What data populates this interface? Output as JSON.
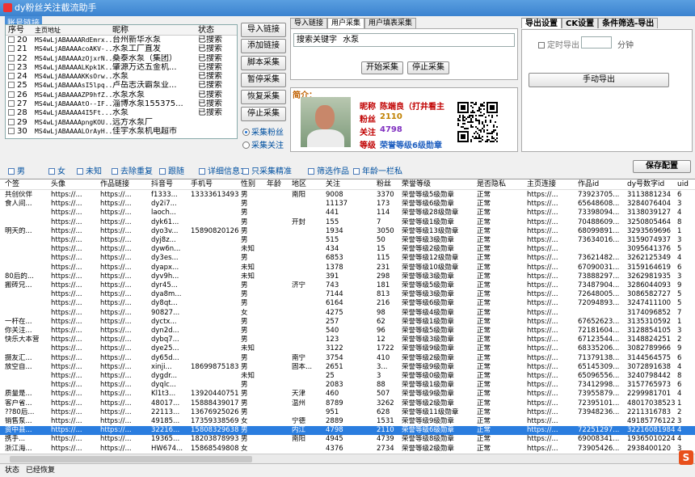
{
  "window": {
    "title": "dy粉丝关注截流助手",
    "group_label": "账号链接"
  },
  "links": {
    "headers": [
      "序号",
      "主页地址",
      "昵称",
      "状态"
    ],
    "rows": [
      [
        "20",
        "MS4wLjABAAAARdEmrx...",
        "台州新华水泵",
        "已搜索"
      ],
      [
        "21",
        "MS4wLjABAAAAcoAKV-...",
        "水泵工厂直发",
        "已搜索"
      ],
      [
        "22",
        "MS4wLjABAAAAzOjxrN...",
        "桑泰水泵（集团）",
        "已搜索"
      ],
      [
        "23",
        "MS4wLjABAAAALKpk1K...",
        "肇源万达五金机...",
        "已搜索"
      ],
      [
        "24",
        "MS4wLjABAAAAKKsOrw...",
        "水泵",
        "已搜索"
      ],
      [
        "25",
        "MS4wLjABAAAAsI5lpq...",
        "卢岳志沃霸泵业...",
        "已搜索"
      ],
      [
        "26",
        "MS4wLjABAAAAZP9hfZ...",
        "水泵水泵",
        "已搜索"
      ],
      [
        "27",
        "MS4wLjABAAAAtO--IF...",
        "淄博水泵155375...",
        "已搜索"
      ],
      [
        "28",
        "MS4wLjABAAAA4I5Ft...",
        "水泵",
        "已搜索"
      ],
      [
        "29",
        "MS4wLjABAAAApngKOU...",
        "远方水泵厂",
        ""
      ],
      [
        "30",
        "MS4wLjABAAAALOrAyH...",
        "佳宇水泵机电超市",
        ""
      ]
    ]
  },
  "buttons": {
    "import": "导入链接",
    "add": "添加链接",
    "script": "脚本采集",
    "pause": "暂停采集",
    "resume": "恢复采集",
    "stop": "停止采集",
    "start_search": "开始采集",
    "stop_search": "停止采集",
    "manual_export": "手动导出",
    "save_config": "保存配置"
  },
  "radios": {
    "fans": "采集粉丝",
    "follow": "采集关注"
  },
  "mid_tabs": [
    "导入链接",
    "用户采集",
    "用户填表采集"
  ],
  "search": {
    "label": "搜索关键字",
    "value": "水泵"
  },
  "profile": {
    "section": "简介：",
    "nick_label": "昵称",
    "nick": "陈端良（打井看主",
    "fans_label": "粉丝",
    "fans": "2110",
    "follow_label": "关注",
    "follow": "4798",
    "level_label": "等级",
    "level": "荣誉等级6级勋章"
  },
  "right_tabs": [
    "导出设置",
    "CK设置",
    "条件筛选-导出"
  ],
  "export": {
    "timed": "定时导出",
    "minutes": "分钟"
  },
  "options": [
    "男",
    "女",
    "未知",
    "去除重复",
    "跟随",
    "详细信息1",
    "只采集精准",
    "筛选作品",
    "年龄一栏私"
  ],
  "table": {
    "headers": [
      "个签",
      "头像",
      "作品链接",
      "抖音号",
      "手机号",
      "性别",
      "年龄",
      "地区",
      "关注",
      "粉丝",
      "荣誉等级",
      "是否隐私",
      "主页连接",
      "作品id",
      "dy号数字id",
      "uid"
    ],
    "rows": [
      [
        "共创伙伴",
        "https://...",
        "https://...",
        "f1333...",
        "13333613493",
        "男",
        "",
        "南阳",
        "9008",
        "3370",
        "荣誉等级5级勋章",
        "正常",
        "https://...",
        "73923705...",
        "3113881234",
        "6"
      ],
      [
        "食人间...",
        "https://...",
        "https://...",
        "dy2i7...",
        "",
        "男",
        "",
        "",
        "11137",
        "173",
        "荣誉等级6级勋章",
        "正常",
        "https://...",
        "65648608...",
        "3284076404",
        "3"
      ],
      [
        "",
        "https://...",
        "https://...",
        "laoch...",
        "",
        "男",
        "",
        "",
        "441",
        "114",
        "荣誉等级28级勋章",
        "正常",
        "https://...",
        "73398094...",
        "3138039127",
        "4"
      ],
      [
        "",
        "https://...",
        "https://...",
        "dyk61...",
        "",
        "男",
        "",
        "开封",
        "155",
        "7",
        "荣誉等级1级勋章",
        "正常",
        "https://...",
        "70488609...",
        "3250805464",
        "8"
      ],
      [
        "明天的...",
        "https://...",
        "https://...",
        "dyo3v...",
        "15890820126",
        "男",
        "",
        "",
        "1934",
        "3050",
        "荣誉等级13级勋章",
        "正常",
        "https://...",
        "68099891...",
        "3293569696",
        "1"
      ],
      [
        "",
        "https://...",
        "https://...",
        "dyj8z...",
        "",
        "男",
        "",
        "",
        "515",
        "50",
        "荣誉等级3级勋章",
        "正常",
        "https://...",
        "73634016...",
        "3159074937",
        "3"
      ],
      [
        "",
        "https://...",
        "https://...",
        "dyw6n...",
        "",
        "未知",
        "",
        "",
        "434",
        "15",
        "荣誉等级2级勋章",
        "正常",
        "https://...",
        "",
        "3095641376",
        "5"
      ],
      [
        "",
        "https://...",
        "https://...",
        "dy3es...",
        "",
        "男",
        "",
        "",
        "6853",
        "115",
        "荣誉等级12级勋章",
        "正常",
        "https://...",
        "73621482...",
        "3262125349",
        "4"
      ],
      [
        "",
        "https://...",
        "https://...",
        "dyapx...",
        "",
        "未知",
        "",
        "",
        "1378",
        "231",
        "荣誉等级10级勋章",
        "正常",
        "https://...",
        "67090031...",
        "3159164619",
        "6"
      ],
      [
        "80后的...",
        "https://...",
        "https://...",
        "dyv9h...",
        "",
        "未知",
        "",
        "",
        "391",
        "298",
        "荣誉等级3级勋章",
        "正常",
        "https://...",
        "73888297...",
        "3262981935",
        "3"
      ],
      [
        "搬砖兄...",
        "https://...",
        "https://...",
        "dyr45...",
        "",
        "男",
        "",
        "济宁",
        "743",
        "181",
        "荣誉等级5级勋章",
        "正常",
        "https://...",
        "73487904...",
        "3286044093",
        "9"
      ],
      [
        "",
        "https://...",
        "https://...",
        "dya8m...",
        "",
        "男",
        "",
        "",
        "7144",
        "813",
        "荣誉等级3级勋章",
        "正常",
        "https://...",
        "72648005...",
        "3086582727",
        "5"
      ],
      [
        "",
        "https://...",
        "https://...",
        "dy8qt...",
        "",
        "男",
        "",
        "",
        "6164",
        "216",
        "荣誉等级6级勋章",
        "正常",
        "https://...",
        "72094893...",
        "3247411100",
        "5"
      ],
      [
        "",
        "https://...",
        "https://...",
        "90827...",
        "",
        "女",
        "",
        "",
        "4275",
        "98",
        "荣誉等级4级勋章",
        "正常",
        "https://...",
        "",
        "3174096852",
        "7"
      ],
      [
        "一杆在...",
        "https://...",
        "https://...",
        "dyctx...",
        "",
        "男",
        "",
        "",
        "257",
        "62",
        "荣誉等级1级勋章",
        "正常",
        "https://...",
        "67652623...",
        "3135310592",
        "1"
      ],
      [
        "你关注...",
        "https://...",
        "https://...",
        "dyn2d...",
        "",
        "男",
        "",
        "",
        "540",
        "96",
        "荣誉等级5级勋章",
        "正常",
        "https://...",
        "72181604...",
        "3128854105",
        "3"
      ],
      [
        "快乐大本营",
        "https://...",
        "https://...",
        "dybq7...",
        "",
        "男",
        "",
        "",
        "123",
        "12",
        "荣誉等级3级勋章",
        "正常",
        "https://...",
        "67123544...",
        "3148824251",
        "2"
      ],
      [
        "",
        "https://...",
        "https://...",
        "dye25...",
        "",
        "未知",
        "",
        "",
        "3122",
        "1722",
        "荣誉等级9级勋章",
        "正常",
        "https://...",
        "68335206...",
        "3082789966",
        "9"
      ],
      [
        "摄友汇...",
        "https://...",
        "https://...",
        "dy65d...",
        "",
        "男",
        "",
        "南宁",
        "3754",
        "410",
        "荣誉等级2级勋章",
        "正常",
        "https://...",
        "71379138...",
        "3144564575",
        "6"
      ],
      [
        "放空自...",
        "https://...",
        "https://...",
        "xinji...",
        "18699875183",
        "男",
        "",
        "固本...",
        "2651",
        "3...",
        "荣誉等级9级勋章",
        "正常",
        "https://...",
        "65145309...",
        "3072891638",
        "4"
      ],
      [
        "",
        "https://...",
        "https://...",
        "dygdr...",
        "",
        "未知",
        "",
        "",
        "25",
        "3",
        "荣誉等级0级勋章",
        "正常",
        "https://...",
        "65096556...",
        "3240798442",
        "8"
      ],
      [
        "",
        "https://...",
        "https://...",
        "dyqlc...",
        "",
        "男",
        "",
        "",
        "2083",
        "88",
        "荣誉等级1级勋章",
        "正常",
        "https://...",
        "73412998...",
        "3157765973",
        "6"
      ],
      [
        "质量是...",
        "https://...",
        "https://...",
        "Kl1t3...",
        "13920440751",
        "男",
        "",
        "天津",
        "460",
        "507",
        "荣誉等级9级勋章",
        "正常",
        "https://...",
        "73955879...",
        "2299981701",
        "4"
      ],
      [
        "客户省...",
        "https://...",
        "https://...",
        "48017...",
        "15888439017",
        "男",
        "",
        "温州",
        "8789",
        "3262",
        "荣誉等级2级勋章",
        "正常",
        "https://...",
        "72395101...",
        "48017038523",
        "1"
      ],
      [
        "??80后...",
        "https://...",
        "https://...",
        "22113...",
        "13676925026",
        "男",
        "",
        "",
        "951",
        "628",
        "荣誉等级11级勋章",
        "正常",
        "https://...",
        "73948236...",
        "2211316783",
        "2"
      ],
      [
        "销售泵...",
        "https://...",
        "https://...",
        "49185...",
        "17359338569",
        "女",
        "",
        "宁德",
        "2889",
        "1531",
        "荣誉等级9级勋章",
        "正常",
        "https://...",
        "",
        "49185776122",
        "3"
      ],
      [
        "资中县...",
        "https://...",
        "https://...",
        "32216...",
        "15808329638",
        "男",
        "",
        "内江",
        "4798",
        "2110",
        "荣誉等级6级勋章",
        "正常",
        "https://...",
        "72251297...",
        "32216081984",
        "4"
      ],
      [
        "携手...",
        "https://...",
        "https://...",
        "19365...",
        "18203878993",
        "男",
        "",
        "南阳",
        "4945",
        "4739",
        "荣誉等级8级勋章",
        "正常",
        "https://...",
        "69008341...",
        "19365010224",
        "4"
      ],
      [
        "浙江海...",
        "https://...",
        "https://...",
        "HW674...",
        "15868549808",
        "女",
        "",
        "",
        "4376",
        "2734",
        "荣誉等级2级勋章",
        "正常",
        "https://...",
        "73905426...",
        "2938400120",
        "3"
      ]
    ],
    "selected_index": 26
  },
  "status": {
    "label": "状态",
    "text": "已经恢复"
  }
}
